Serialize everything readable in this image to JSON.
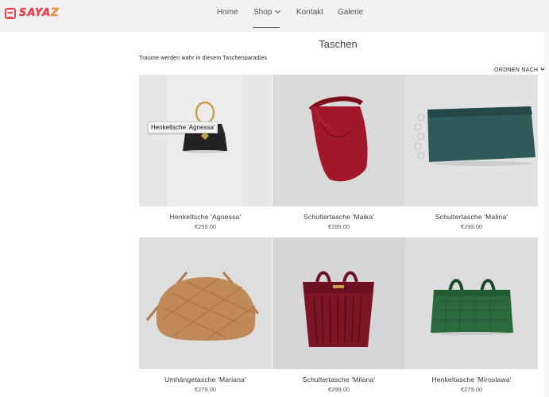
{
  "header": {
    "logo_text_1": "SAYA",
    "logo_text_2": "Z",
    "nav": {
      "home": "Home",
      "shop": "Shop",
      "kontakt": "Kontakt",
      "galerie": "Galerie"
    }
  },
  "main": {
    "title": "Taschen",
    "tagline": "Traume werden wahr in diesem Taschenparadies",
    "sort_label": "ORDNEN NACH"
  },
  "tooltip": "Henkeltsche 'Agnessa'",
  "products": [
    {
      "name": "Henkeltsche 'Agnessa'",
      "price": "€259.00"
    },
    {
      "name": "Schultertasche 'Maika'",
      "price": "€289.00"
    },
    {
      "name": "Schultertasche 'Malina'",
      "price": "€299.00"
    },
    {
      "name": "Umhängetasche 'Mariana'",
      "price": "€279.00"
    },
    {
      "name": "Schultertasche 'Milana'",
      "price": "€299.00"
    },
    {
      "name": "Henkeltasche 'Miroslawa'",
      "price": "€279.00"
    }
  ],
  "colors": {
    "brand_red": "#e8434a",
    "brand_orange": "#f2a13a",
    "header_bg": "#f2f2f2"
  }
}
